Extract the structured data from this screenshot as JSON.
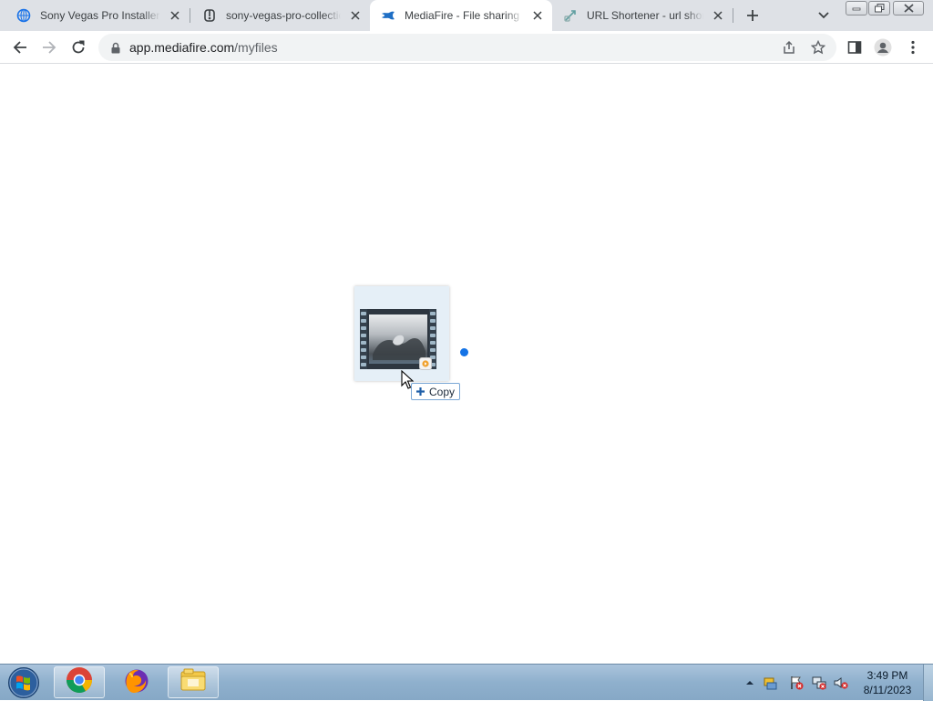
{
  "browser": {
    "tabs": [
      {
        "title": "Sony Vegas Pro Installers",
        "favicon": "globe-icon"
      },
      {
        "title": "sony-vegas-pro-collection",
        "favicon": "archive-icon"
      },
      {
        "title": "MediaFire - File sharing and storage",
        "favicon": "mediafire-icon",
        "active": true
      },
      {
        "title": "URL Shortener - url shortener",
        "favicon": "link-icon"
      }
    ],
    "url_host": "app.mediafire.com",
    "url_path": "/myfiles"
  },
  "drag": {
    "tooltip_label": "Copy",
    "tooltip_icon": "plus-icon",
    "item_icon": "video-file-icon"
  },
  "taskbar": {
    "apps": [
      "chrome-icon",
      "firefox-icon",
      "file-explorer-icon"
    ],
    "time": "3:49 PM",
    "date": "8/11/2023"
  },
  "colors": {
    "accent": "#1473e6",
    "tab_strip": "#dee1e6",
    "taskbar": "#8fb0cd"
  }
}
